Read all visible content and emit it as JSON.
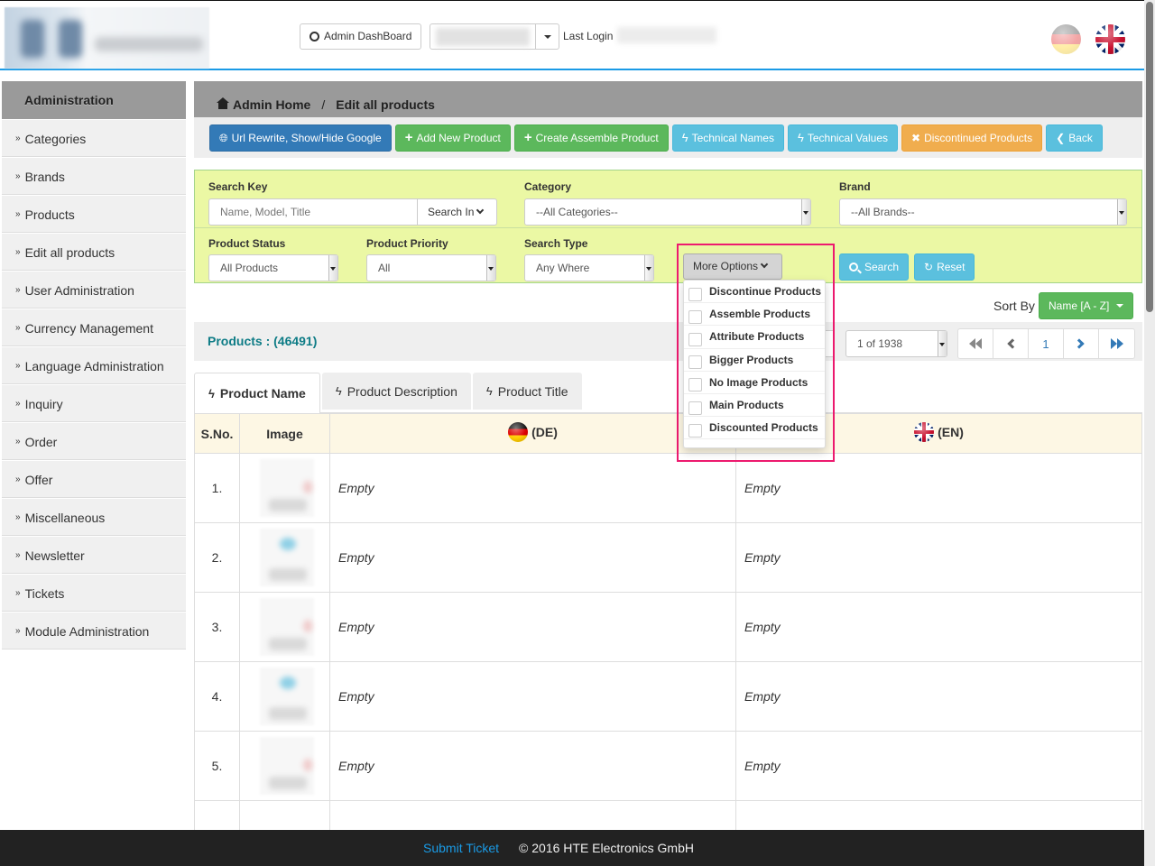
{
  "header": {
    "dashboard_button": "Admin DashBoard",
    "last_login_label": "Last Login",
    "languages": [
      "de",
      "en"
    ]
  },
  "sidebar": {
    "title": "Administration",
    "items": [
      {
        "label": "Categories"
      },
      {
        "label": "Brands"
      },
      {
        "label": "Products"
      },
      {
        "label": "Edit all products"
      },
      {
        "label": "User Administration"
      },
      {
        "label": "Currency Management"
      },
      {
        "label": "Language Administration"
      },
      {
        "label": "Inquiry"
      },
      {
        "label": "Order"
      },
      {
        "label": "Offer"
      },
      {
        "label": "Miscellaneous"
      },
      {
        "label": "Newsletter"
      },
      {
        "label": "Tickets"
      },
      {
        "label": "Module Administration"
      }
    ]
  },
  "breadcrumb": {
    "home": "Admin Home",
    "separator": "/",
    "current": "Edit all products"
  },
  "toolbar": {
    "url_rewrite": "Url Rewrite, Show/Hide Google",
    "add_new_product": "Add New Product",
    "create_assemble_product": "Create Assemble Product",
    "technical_names": "Technical Names",
    "technical_values": "Technical Values",
    "discontinued_products": "Discontinued Products",
    "back": "Back"
  },
  "filters": {
    "search_key_label": "Search Key",
    "search_key_placeholder": "Name, Model, Title",
    "search_key_value": "",
    "search_in": "Search In",
    "category_label": "Category",
    "category_value": "--All Categories--",
    "brand_label": "Brand",
    "brand_value": "--All Brands--",
    "product_status_label": "Product Status",
    "product_status_value": "All Products",
    "product_priority_label": "Product Priority",
    "product_priority_value": "All",
    "search_type_label": "Search Type",
    "search_type_value": "Any Where",
    "more_options": "More Options",
    "search_button": "Search",
    "reset_button": "Reset"
  },
  "more_options_menu": [
    {
      "label": "Discontinue Products",
      "checked": false
    },
    {
      "label": "Assemble Products",
      "checked": false
    },
    {
      "label": "Attribute Products",
      "checked": false
    },
    {
      "label": "Bigger Products",
      "checked": false
    },
    {
      "label": "No Image Products",
      "checked": false
    },
    {
      "label": "Main Products",
      "checked": false
    },
    {
      "label": "Discounted Products",
      "checked": false
    }
  ],
  "sort": {
    "label": "Sort By",
    "value": "Name [A - Z]"
  },
  "listing": {
    "products_count": "Products : (46491)",
    "page_select": "1 of 1938",
    "current_page": "1"
  },
  "tabs": [
    {
      "label": "Product Name",
      "active": true
    },
    {
      "label": "Product Description",
      "active": false
    },
    {
      "label": "Product Title",
      "active": false
    }
  ],
  "table": {
    "columns": [
      "S.No.",
      "Image",
      "(DE)",
      "(EN)"
    ],
    "rows": [
      {
        "sno": "1.",
        "de": "Empty",
        "en": "Empty"
      },
      {
        "sno": "2.",
        "de": "Empty",
        "en": "Empty"
      },
      {
        "sno": "3.",
        "de": "Empty",
        "en": "Empty"
      },
      {
        "sno": "4.",
        "de": "Empty",
        "en": "Empty"
      },
      {
        "sno": "5.",
        "de": "Empty",
        "en": "Empty"
      },
      {
        "sno": "",
        "de": "",
        "en": ""
      }
    ]
  },
  "footer": {
    "submit_ticket": "Submit Ticket",
    "copyright": "© 2016 HTE Electronics GmbH"
  },
  "colors": {
    "accent_blue": "#1a9be6",
    "primary": "#337ab7",
    "success": "#5cb85c",
    "info": "#5bc0de",
    "warning": "#f0ad4e",
    "filter_bg": "#ebf8a4",
    "highlight": "#ed1a6f",
    "count_text": "#0e7c86"
  }
}
